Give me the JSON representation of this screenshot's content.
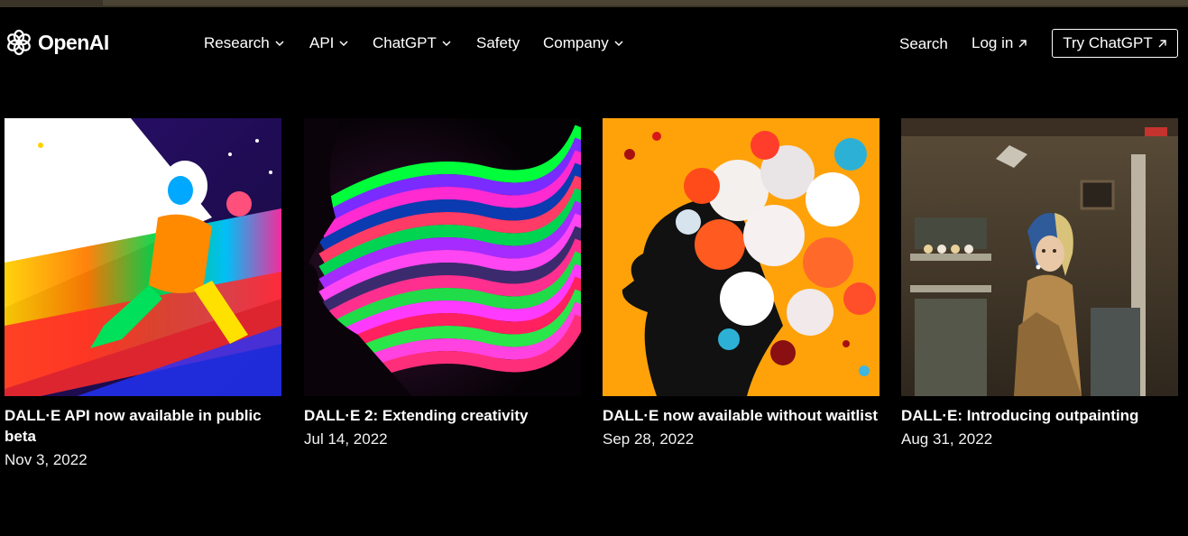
{
  "brand": {
    "name": "OpenAI"
  },
  "nav": {
    "items": [
      {
        "label": "Research",
        "has_dropdown": true
      },
      {
        "label": "API",
        "has_dropdown": true
      },
      {
        "label": "ChatGPT",
        "has_dropdown": true
      },
      {
        "label": "Safety",
        "has_dropdown": false
      },
      {
        "label": "Company",
        "has_dropdown": true
      }
    ],
    "search_label": "Search",
    "login_label": "Log in",
    "cta_label": "Try ChatGPT"
  },
  "cards": [
    {
      "title": "DALL·E API now available in public beta",
      "date": "Nov 3, 2022",
      "image_icon": "astronaut-painting-image"
    },
    {
      "title": "DALL·E 2: Extending creativity",
      "date": "Jul 14, 2022",
      "image_icon": "rainbow-profile-image"
    },
    {
      "title": "DALL·E now available without waitlist",
      "date": "Sep 28, 2022",
      "image_icon": "flower-head-silhouette-image"
    },
    {
      "title": "DALL·E: Introducing outpainting",
      "date": "Aug 31, 2022",
      "image_icon": "girl-pearl-earring-outpainting-image"
    }
  ],
  "colors": {
    "background": "#000000",
    "text": "#ffffff",
    "topbar": "#3a3428"
  }
}
